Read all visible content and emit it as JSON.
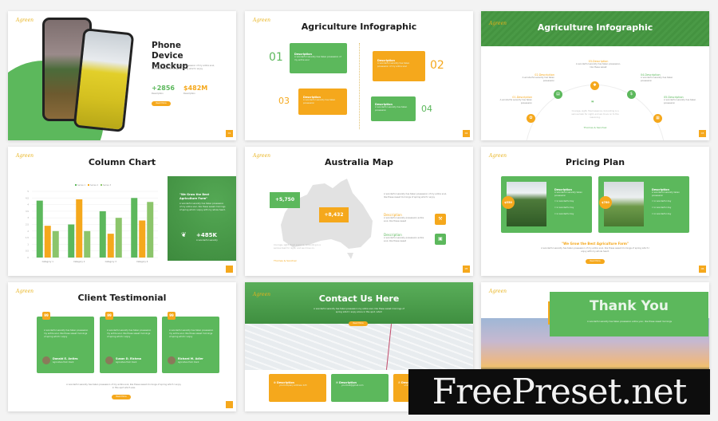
{
  "logo": "Agreen",
  "lorem": "A wonderful serenity has taken possession of my entire soul, like these sweet mornings of spring which I enjoy",
  "lorem_short": "A wonderful serenity has taken possession",
  "colors": {
    "green": "#5cb85c",
    "orange": "#f5a81c",
    "dark_green": "#3e8e41"
  },
  "slide1": {
    "title": "Phone Device Mockup",
    "text": "A wonderful serenity has taken possession of my entire soul, like these sweet mornings of spring which I enjoy",
    "stat1": "+2856",
    "stat1_label": "Description",
    "stat2": "$482M",
    "stat2_label": "Description",
    "button": "Read More",
    "page": "01"
  },
  "slide2": {
    "title": "Agriculture Infographic",
    "items": [
      {
        "num": "01",
        "label": "Description",
        "text": "A wonderful serenity has taken possession of my entire soul"
      },
      {
        "num": "02",
        "label": "Description",
        "text": "A wonderful serenity has taken possession of my entire soul"
      },
      {
        "num": "03",
        "label": "Description",
        "text": "A wonderful serenity has taken possession"
      },
      {
        "num": "04",
        "label": "Description",
        "text": "A wonderful serenity has taken possession"
      }
    ],
    "page": "02"
  },
  "slide3": {
    "title": "Agriculture Infographic",
    "items": [
      {
        "label": "01.Description",
        "text": "A wonderful serenity has taken possession"
      },
      {
        "label": "02.Description",
        "text": "A wonderful serenity has taken possession"
      },
      {
        "label": "03.Description",
        "text": "A wonderful serenity has taken possession, like these sweet"
      },
      {
        "label": "04.Description",
        "text": "A wonderful serenity has taken possession"
      },
      {
        "label": "05.Description",
        "text": "A wonderful serenity has taken possession"
      }
    ],
    "quote": "Courage, sight, fixed essence. Grounding is a serious task for night, and we move on to the reasoning.",
    "author": "Thomas & Sanchez",
    "page": "03"
  },
  "slide4": {
    "title": "Column Chart",
    "panel_title": "\"We Grow the Best Agriculture Farm\"",
    "panel_text": "A wonderful serenity has taken possession of my entire soul, like these sweet mornings of spring which I enjoy with my whole heart.",
    "panel_stat": "+485K",
    "panel_stat_label": "A wonderful serenity",
    "page": "04"
  },
  "chart_data": {
    "type": "bar",
    "categories": [
      "Category 1",
      "Category 2",
      "Category 3",
      "Category 4"
    ],
    "series": [
      {
        "name": "Series 1",
        "color": "#5cb85c",
        "values": [
          4.3,
          2.5,
          3.5,
          4.5
        ]
      },
      {
        "name": "Series 2",
        "color": "#f5a81c",
        "values": [
          2.4,
          4.4,
          1.8,
          2.8
        ]
      },
      {
        "name": "Series 3",
        "color": "#8cc56b",
        "values": [
          2.0,
          2.0,
          3.0,
          4.2
        ]
      }
    ],
    "ylim": [
      0,
      5
    ],
    "yticks": [
      0,
      0.5,
      1,
      1.5,
      2,
      2.5,
      3,
      3.5,
      4,
      4.5,
      5
    ],
    "grid": true,
    "legend": "top"
  },
  "slide5": {
    "title": "Australia Map",
    "stat1": "+5,750",
    "stat2": "+8,432",
    "text": "A wonderful serenity has taken possession of my entire soul, like these sweet mornings of spring which I enjoy",
    "items": [
      {
        "label": "Description",
        "text": "A wonderful serenity possession entire soul, like these sweet"
      },
      {
        "label": "Description",
        "text": "A wonderful serenity possession entire soul, like these sweet"
      }
    ],
    "quote": "Courage, sight, fixed essence. Grounding is a serious task for night, and we move on.",
    "author": "Thomas & Sanchez",
    "page": "05"
  },
  "slide6": {
    "title": "Pricing Plan",
    "plans": [
      {
        "price": "$550",
        "label": "Description",
        "text": "A wonderful serenity taken possession",
        "features": [
          "A wonderful day",
          "A wonderful day",
          "A wonderful day"
        ]
      },
      {
        "price": "$780",
        "label": "Description",
        "text": "A wonderful serenity taken possession",
        "features": [
          "A wonderful day",
          "A wonderful day",
          "A wonderful day"
        ]
      }
    ],
    "quote": "\"We Grow the Best Agriculture Farm\"",
    "text": "A wonderful serenity has taken possession of my entire soul, like these sweet mornings of spring which I enjoy with my whole heart.",
    "button": "Read More",
    "page": "06"
  },
  "slide7": {
    "title": "Client Testimonial",
    "cards": [
      {
        "text": "A wonderful serenity has taken possession my entire soul, like these sweet mornings of spring which I enjoy",
        "name": "Donald E. Antles",
        "role": "Agriculture Farm Client"
      },
      {
        "text": "A wonderful serenity has taken possession my entire soul, like these sweet mornings of spring which I enjoy",
        "name": "Susan D. Richma",
        "role": "Agriculture Farm Client"
      },
      {
        "text": "A wonderful serenity has taken possession my entire soul, like these sweet mornings of spring which I enjoy",
        "name": "Richard M. Adler",
        "role": "Agriculture Farm Client"
      }
    ],
    "text": "A wonderful serenity has taken possession of my entire soul, like these sweet mornings of spring which I enjoy in this spot which was",
    "button": "Read More",
    "quote_mark": "99"
  },
  "slide8": {
    "title": "Contact Us Here",
    "text": "A wonderful serenity has taken possession my entire soul, like these sweet mornings of spring which I enjoy alone in this spot, which",
    "button": "Read More",
    "cards": [
      {
        "label": "Description",
        "text": "yourcompany address 123"
      },
      {
        "label": "Description",
        "text": "yourmail@gmail.com"
      },
      {
        "label": "Description",
        "text": "+123 456 789"
      }
    ]
  },
  "slide9": {
    "title": "Thank You",
    "text": "A wonderful serenity has taken possession entire your, like these sweet mornings"
  },
  "watermark": "FreePreset.net"
}
